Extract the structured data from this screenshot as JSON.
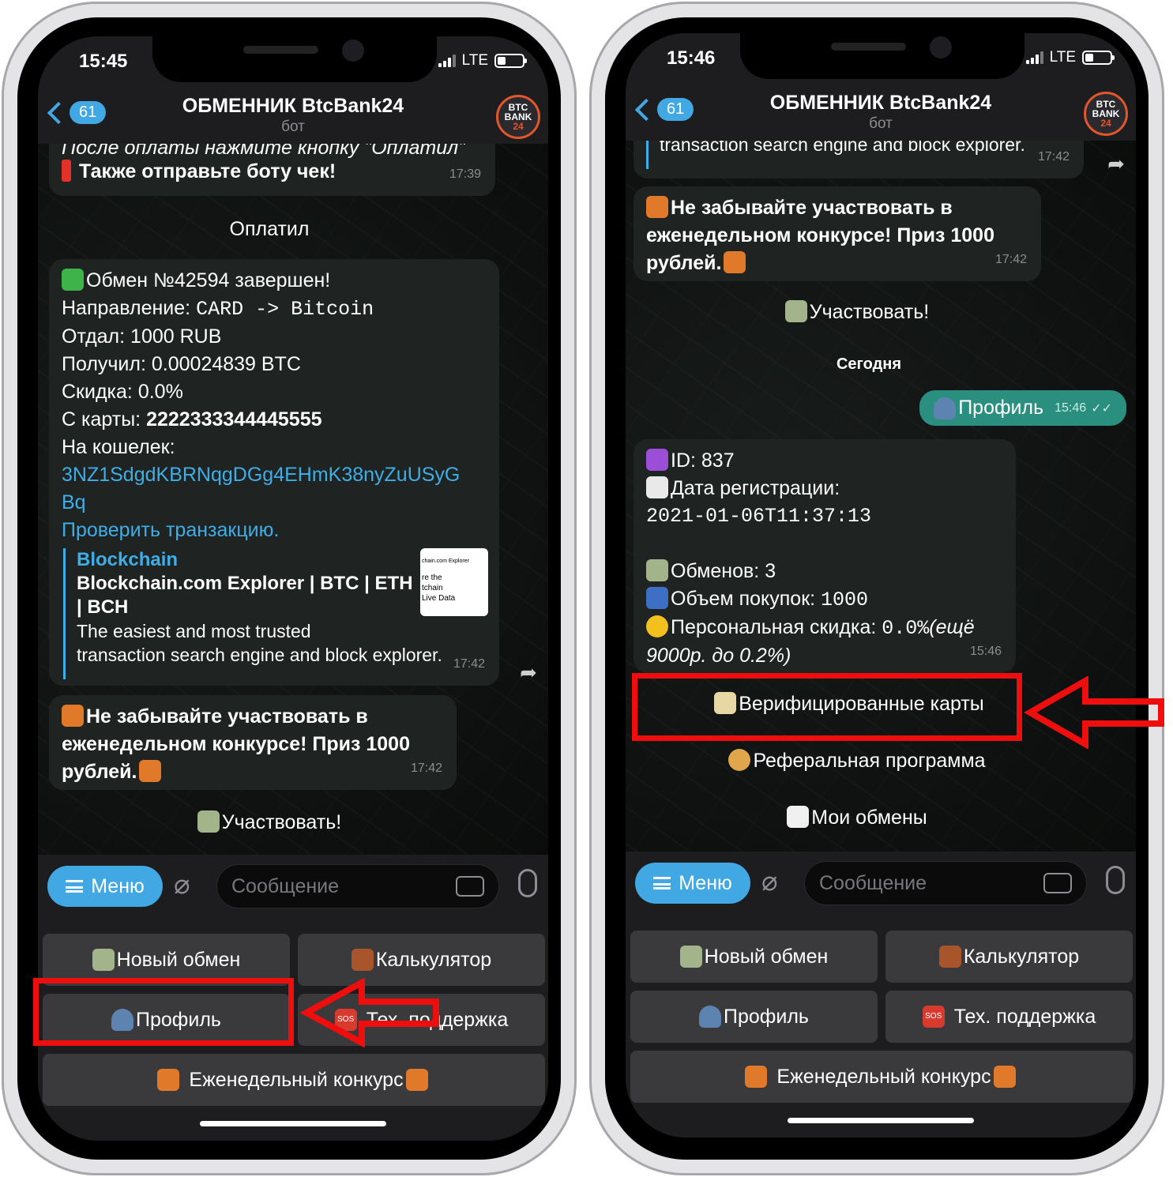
{
  "left": {
    "status": {
      "time": "15:45",
      "network": "LTE"
    },
    "header": {
      "back_count": "61",
      "title": "ОБМЕННИК BtcBank24",
      "subtitle": "бот",
      "avatar_line1": "BTC",
      "avatar_line2": "BANK",
      "avatar_line3": "24"
    },
    "msg1": {
      "line1": "После оплаты нажмите кнопку \"Оплатил\"",
      "line2": "Также отправьте боту чек!",
      "time": "17:39"
    },
    "btn_paid": "Оплатил",
    "exchange": {
      "completed": "Обмен №42594 завершен!",
      "direction_label": "Направление: ",
      "direction_value": "CARD -> Bitcoin",
      "gave": "Отдал: 1000 RUB",
      "got": "Получил: 0.00024839 BTC",
      "discount": "Скидка: 0.0%",
      "card_label": "С карты: ",
      "card_value": "2222333344445555",
      "wallet_label": "На кошелек:",
      "wallet_line1": "3NZ1SdgdKBRNqgDGg4EHmK38nyZuUSyG",
      "wallet_line2": "Bq",
      "check_link": "Проверить транзакцию.",
      "preview_site": "Blockchain",
      "preview_title": "Blockchain.com Explorer | BTC | ETH | BCH",
      "preview_desc1": "The easiest and most trusted",
      "preview_desc2": "transaction search engine and block explorer.",
      "thumb_top": "chain.com Explorer",
      "thumb_l1": "re the",
      "thumb_l2": "tchain",
      "thumb_l3": "Live Data",
      "time": "17:42"
    },
    "contest": {
      "line1": "Не забывайте участвовать в",
      "line2": "еженедельном конкурсе! Приз 1000",
      "line3": "рублей.",
      "time": "17:42"
    },
    "btn_participate": "Участвовать!",
    "composer": {
      "menu": "Меню",
      "placeholder": "Сообщение"
    },
    "keyboard": {
      "new_exchange": "Новый обмен",
      "calculator": "Калькулятор",
      "profile": "Профиль",
      "sos": "SOS",
      "support": "Тех. поддержка",
      "contest": "Еженедельный конкурс"
    }
  },
  "right": {
    "status": {
      "time": "15:46",
      "network": "LTE"
    },
    "header": {
      "back_count": "61",
      "title": "ОБМЕННИК BtcBank24",
      "subtitle": "бот",
      "avatar_line1": "BTC",
      "avatar_line2": "BANK",
      "avatar_line3": "24"
    },
    "msg_top": {
      "text": "transaction search engine and block explorer.",
      "time": "17:42"
    },
    "contest": {
      "line1": "Не забывайте участвовать в",
      "line2": "еженедельном конкурсе! Приз 1000",
      "line3": "рублей.",
      "time": "17:42"
    },
    "btn_participate": "Участвовать!",
    "date_chip": "Сегодня",
    "outgoing": {
      "text": "Профиль",
      "time": "15:46"
    },
    "profile": {
      "id": "ID: 837",
      "reg_label": "Дата регистрации:",
      "reg_value": "2021-01-06T11:37:13",
      "exchanges": "Обменов: 3",
      "volume_label": "Объем покупок: ",
      "volume_value": "1000",
      "discount_label": "Персональная скидка: ",
      "discount_value": "0.0%",
      "discount_note1": "(ещё",
      "discount_note2": "9000р. до 0.2%)",
      "time": "15:46"
    },
    "btn_verified": "Верифицированные карты",
    "btn_referral": "Реферальная программа",
    "btn_my_exchanges": "Мои обмены",
    "composer": {
      "menu": "Меню",
      "placeholder": "Сообщение"
    },
    "keyboard": {
      "new_exchange": "Новый обмен",
      "calculator": "Калькулятор",
      "profile": "Профиль",
      "sos": "SOS",
      "support": "Тех. поддержка",
      "contest": "Еженедельный конкурс"
    }
  },
  "colors": {
    "accent": "#41a8e4",
    "outgoing_bubble": "#2b8f80",
    "highlight": "#ee0e0e"
  }
}
